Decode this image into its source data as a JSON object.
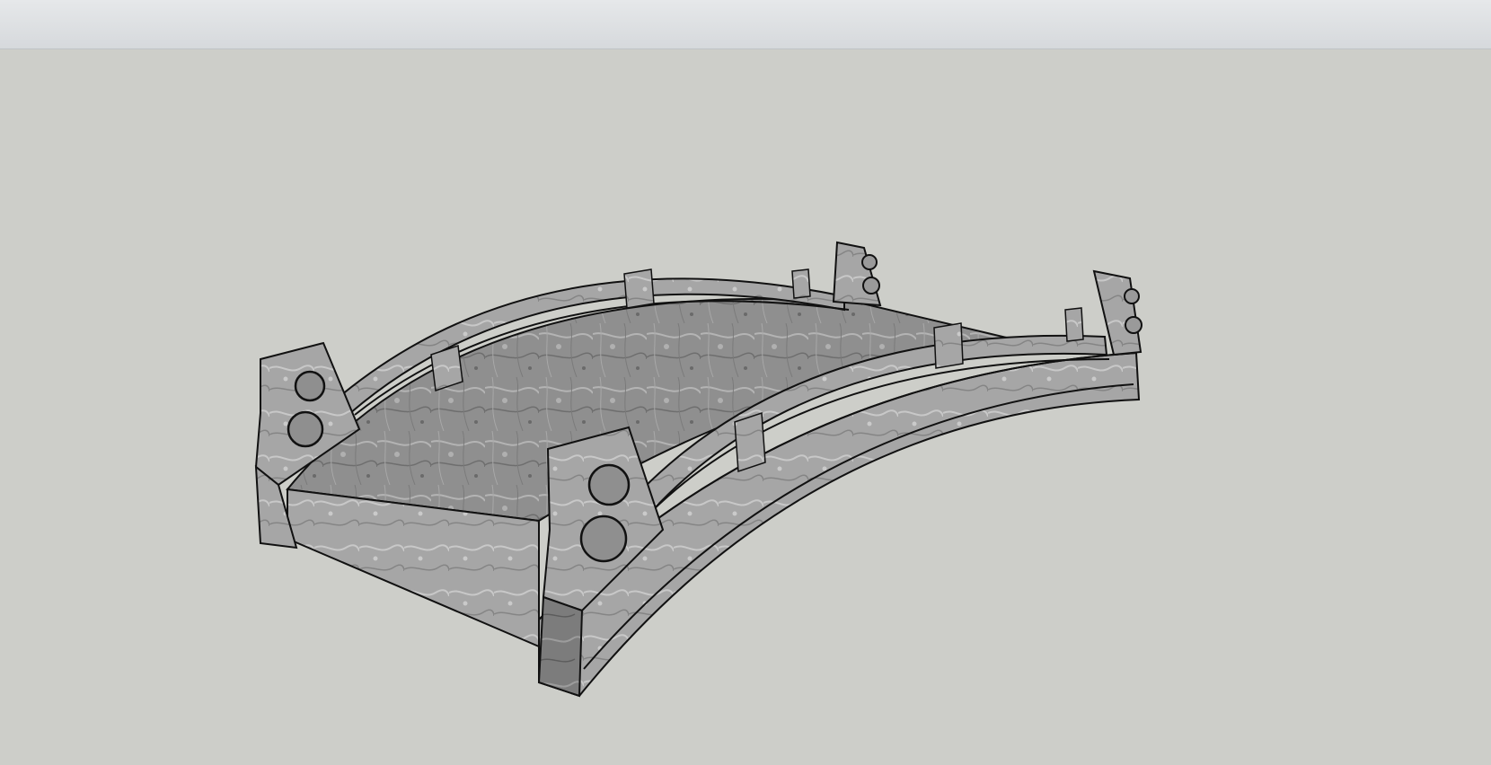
{
  "app": {
    "colors": {
      "toolbar": "#dfe2e4",
      "viewport_background": "#cdcec9",
      "model_fill_light": "#a3a3a3",
      "model_fill_dark": "#737373",
      "edge": "#111111"
    }
  },
  "toolbar": {},
  "viewport": {
    "model": "arched-bridge"
  }
}
